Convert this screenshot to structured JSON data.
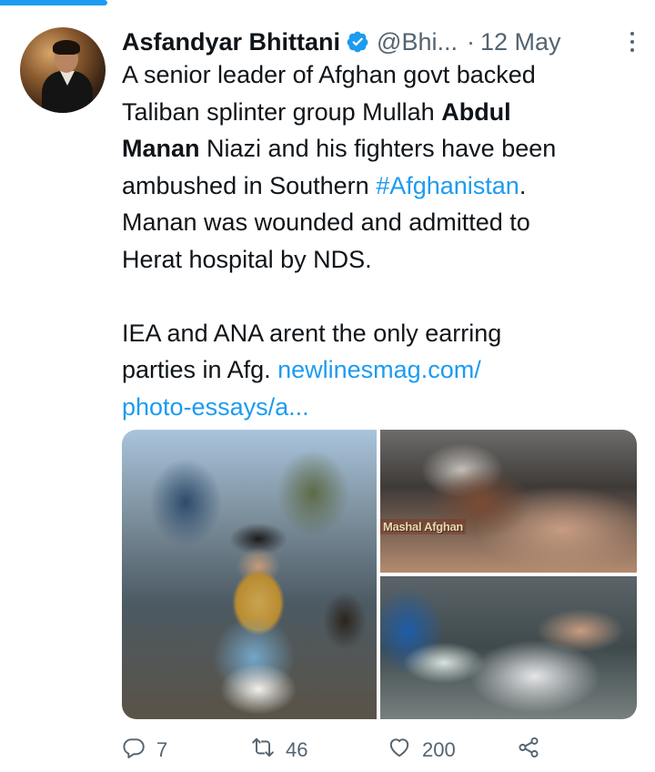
{
  "tweet": {
    "author_name": "Asfandyar Bhittani",
    "handle": "@Bhi...",
    "separator": "·",
    "date": "12 May",
    "text_lines": [
      [
        {
          "t": "A senior leader of Afghan govt backed"
        }
      ],
      [
        {
          "t": "Taliban splinter group Mullah "
        },
        {
          "t": "Abdul",
          "b": true
        }
      ],
      [
        {
          "t": "Manan",
          "b": true
        },
        {
          "t": " Niazi and his fighters have been"
        }
      ],
      [
        {
          "t": "ambushed in Southern "
        },
        {
          "t": "#Afghanistan",
          "l": true
        },
        {
          "t": "."
        }
      ],
      [
        {
          "t": "Manan was wounded and admitted to"
        }
      ],
      [
        {
          "t": "Herat hospital by NDS."
        }
      ],
      [
        {
          "t": ""
        }
      ],
      [
        {
          "t": "IEA and ANA arent the only earring"
        }
      ],
      [
        {
          "t": "parties in Afg. "
        },
        {
          "t": "newlinesmag.com/",
          "l": true
        }
      ],
      [
        {
          "t": "photo-essays/a...",
          "l": true
        }
      ]
    ],
    "media_watermark": "Mashal Afghan",
    "stats": {
      "replies": "7",
      "retweets": "46",
      "likes": "200"
    }
  },
  "colors": {
    "accent": "#1d9bf0",
    "text": "#0f1419",
    "secondary": "#536471"
  },
  "icons": {
    "verified": "verified-badge-icon",
    "more": "more-options-icon",
    "reply": "reply-icon",
    "retweet": "retweet-icon",
    "like": "heart-icon",
    "share": "share-icon"
  }
}
